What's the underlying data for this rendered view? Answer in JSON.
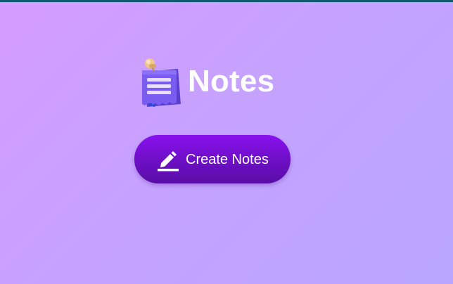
{
  "app": {
    "title": "Notes",
    "icon": "notepad-pin-icon"
  },
  "actions": {
    "create_label": "Create Notes",
    "create_icon": "pencil-edit-icon"
  },
  "colors": {
    "background_start": "#d49cff",
    "background_end": "#b9a5ff",
    "button_top": "#8a10ee",
    "button_bottom": "#5a0da6",
    "text": "#ffffff"
  }
}
